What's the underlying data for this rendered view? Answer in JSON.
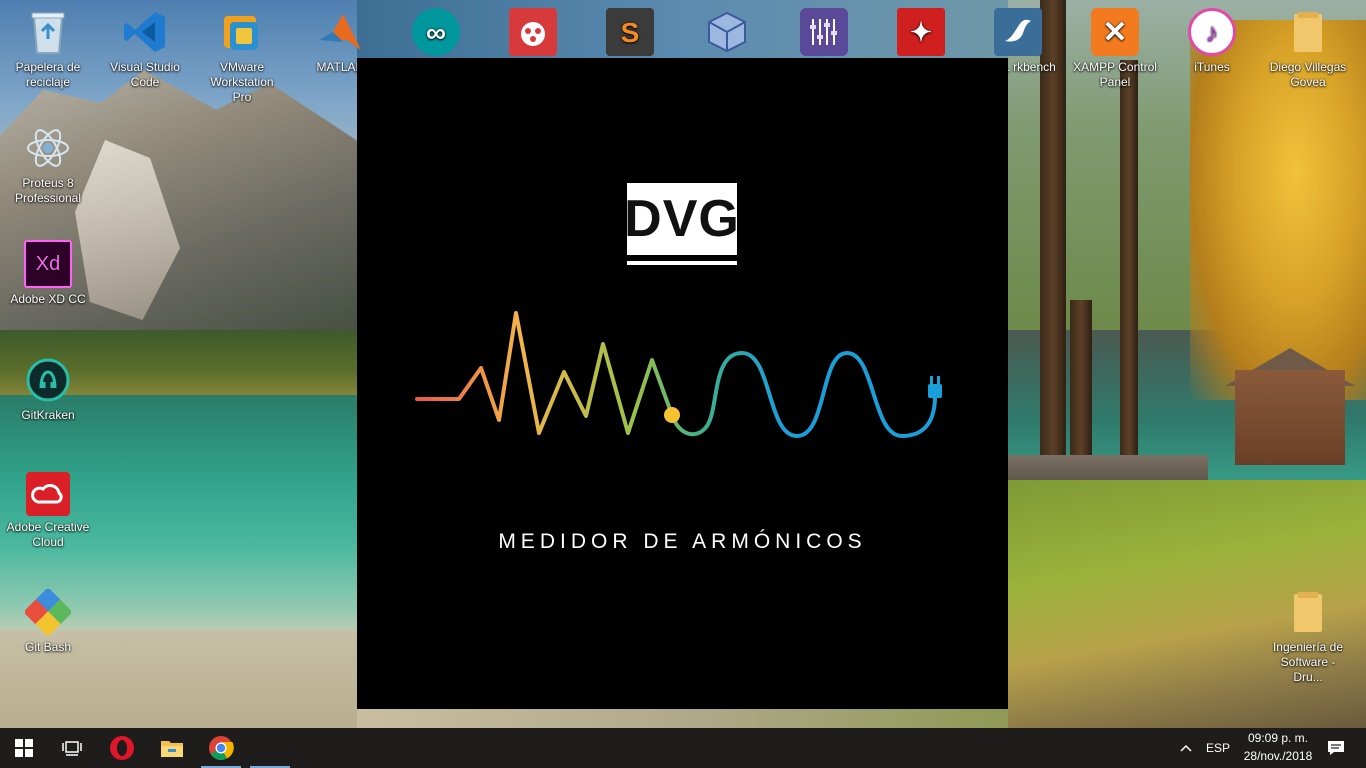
{
  "desktop": {
    "icons": [
      {
        "label": "Papelera de reciclaje",
        "name": "recycle-bin-icon",
        "color": "#9fb7c9"
      },
      {
        "label": "Visual Studio Code",
        "name": "vscode-icon",
        "color": "#1f7bd0"
      },
      {
        "label": "VMware Workstation Pro",
        "name": "vmware-icon",
        "color": "#f0a21c"
      },
      {
        "label": "MATLAB",
        "name": "matlab-icon",
        "color": "#e86a1f"
      },
      {
        "label": "",
        "name": "arduino-icon",
        "color": "#00979d"
      },
      {
        "label": "",
        "name": "app-red-icon",
        "color": "#d63a3a"
      },
      {
        "label": "",
        "name": "sublime-text-icon",
        "color": "#f58a21"
      },
      {
        "label": "",
        "name": "virtualbox-icon",
        "color": "#6d8fc8"
      },
      {
        "label": "",
        "name": "mixer-app-icon",
        "color": "#6a52a8"
      },
      {
        "label": "",
        "name": "acrobat-icon",
        "color": "#cf1f1f"
      },
      {
        "label": "ySQL rkbench",
        "name": "mysql-workbench-icon",
        "color": "#3a6e99"
      },
      {
        "label": "XAMPP Control Panel",
        "name": "xampp-icon",
        "color": "#f47a20"
      },
      {
        "label": "iTunes",
        "name": "itunes-icon",
        "color": "#e34aa8"
      },
      {
        "label": "Diego Villegas Govea",
        "name": "user-folder-icon",
        "color": "#f0c76a"
      },
      {
        "label": "Proteus 8 Professional",
        "name": "proteus-icon",
        "color": "#8fb7d9"
      },
      {
        "label": "Adobe XD CC",
        "name": "adobe-xd-icon",
        "color": "#470137"
      },
      {
        "label": "GitKraken",
        "name": "gitkraken-icon",
        "color": "#179287"
      },
      {
        "label": "Adobe Creative Cloud",
        "name": "creative-cloud-icon",
        "color": "#da1f26"
      },
      {
        "label": "Git Bash",
        "name": "git-bash-icon",
        "color": "#f05133"
      },
      {
        "label": "Ingeniería de Software - Dru...",
        "name": "folder-icon",
        "color": "#f0c76a"
      }
    ],
    "glyphs": {
      "vscode": "⟩",
      "matlab": "▲",
      "arduino": "∞",
      "sublime": "S",
      "acrobat": "✦",
      "xd": "Xd",
      "itunes": "♪",
      "xampp": "✕"
    }
  },
  "app": {
    "logo_text": "DVG",
    "title": "MEDIDOR DE ARMÓNICOS",
    "colors": {
      "background": "#000000",
      "wave_start": "#e85a4a",
      "wave_mid": "#9bc24a",
      "wave_end": "#1a9fd8",
      "dot": "#f5c230"
    }
  },
  "taskbar": {
    "language": "ESP",
    "time": "09:09 p. m.",
    "date": "28/nov./2018",
    "icons": [
      "windows-start-icon",
      "task-view-icon",
      "opera-icon",
      "file-explorer-icon",
      "chrome-icon"
    ],
    "tray_icons": [
      "chevron-up-icon",
      "notifications-icon"
    ]
  }
}
